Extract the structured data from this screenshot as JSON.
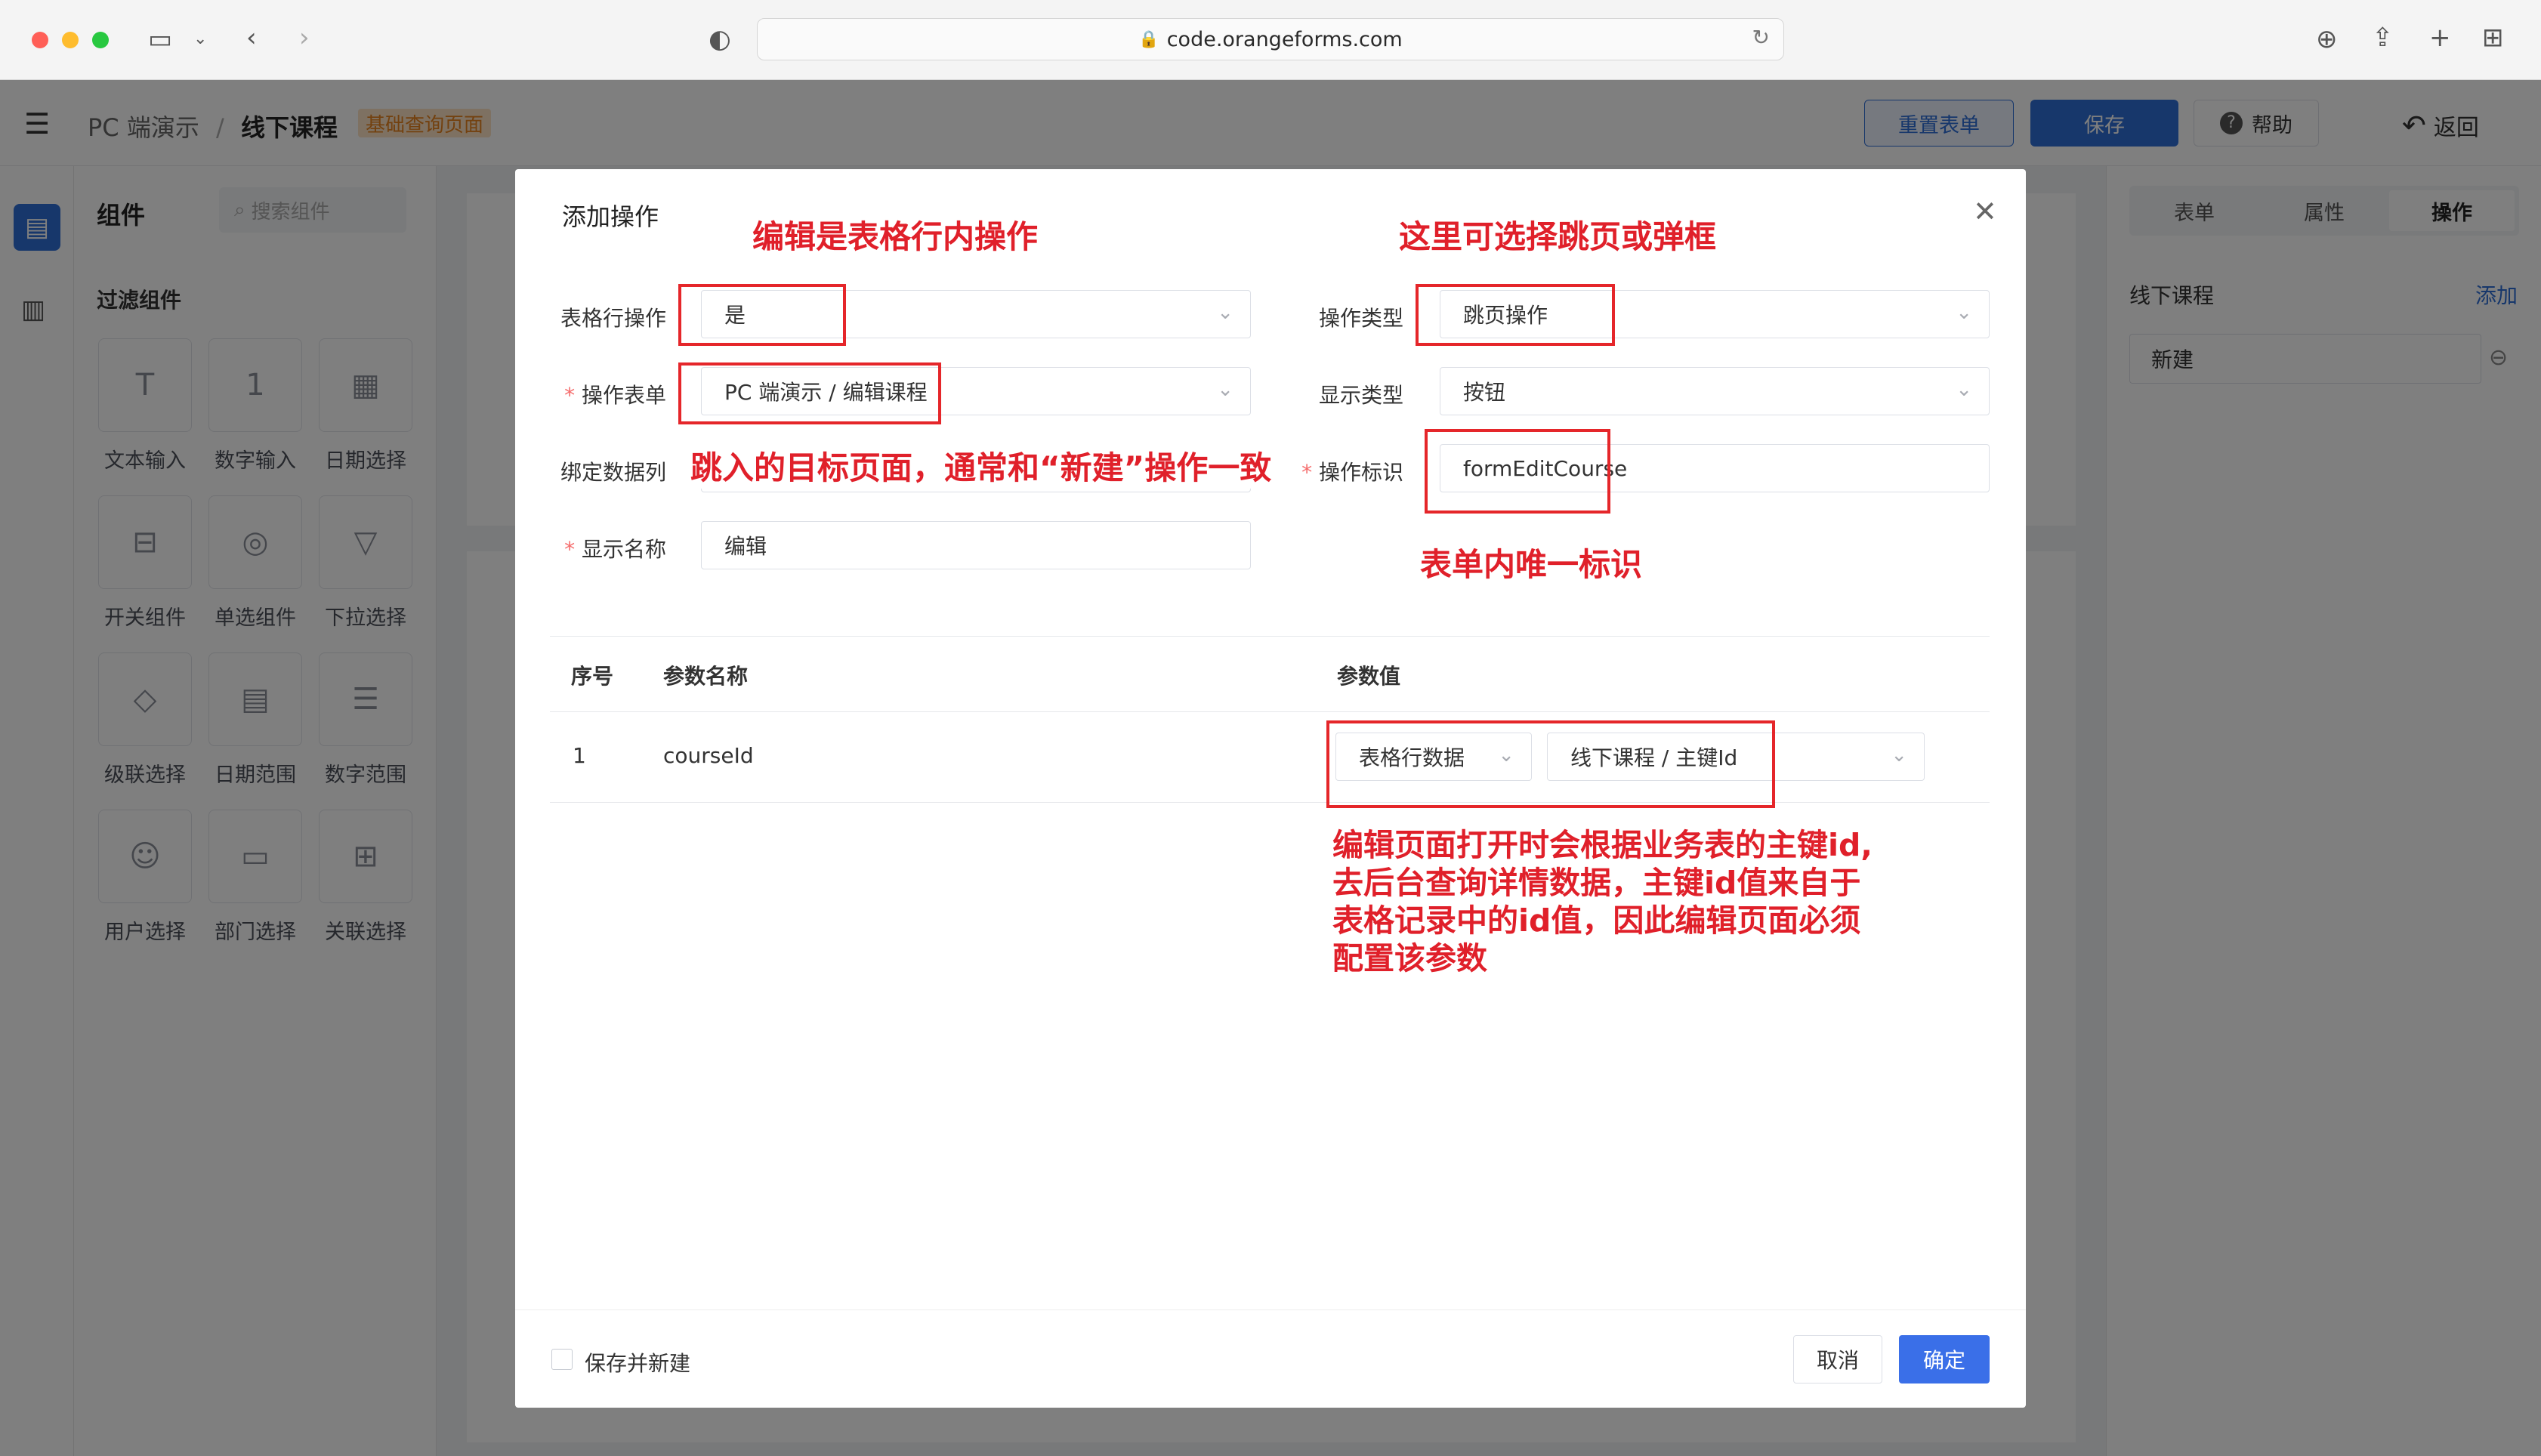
{
  "browser": {
    "url": "code.orangeforms.com"
  },
  "header": {
    "breadcrumb_root": "PC 端演示",
    "breadcrumb_sep": "/",
    "breadcrumb_current": "线下课程",
    "page_tag": "基础查询页面",
    "reset_label": "重置表单",
    "save_label": "保存",
    "help_label": "帮助",
    "back_label": "返回"
  },
  "left_panel": {
    "title": "组件",
    "search_placeholder": "搜索组件",
    "section_title": "过滤组件",
    "components": [
      {
        "label": "文本输入",
        "icon": "text-input-icon",
        "glyph": "T"
      },
      {
        "label": "数字输入",
        "icon": "number-input-icon",
        "glyph": "1"
      },
      {
        "label": "日期选择",
        "icon": "date-picker-icon",
        "glyph": "▦"
      },
      {
        "label": "开关组件",
        "icon": "switch-icon",
        "glyph": "⊟"
      },
      {
        "label": "单选组件",
        "icon": "radio-icon",
        "glyph": "◎"
      },
      {
        "label": "下拉选择",
        "icon": "dropdown-icon",
        "glyph": "▽"
      },
      {
        "label": "级联选择",
        "icon": "cascader-icon",
        "glyph": "◇"
      },
      {
        "label": "日期范围",
        "icon": "date-range-icon",
        "glyph": "▤"
      },
      {
        "label": "数字范围",
        "icon": "number-range-icon",
        "glyph": "☰"
      },
      {
        "label": "用户选择",
        "icon": "user-select-icon",
        "glyph": "☺"
      },
      {
        "label": "部门选择",
        "icon": "dept-select-icon",
        "glyph": "▭"
      },
      {
        "label": "关联选择",
        "icon": "relation-select-icon",
        "glyph": "⊞"
      }
    ]
  },
  "right_panel": {
    "tabs": [
      "表单",
      "属性",
      "操作"
    ],
    "active_tab": "操作",
    "section_title": "线下课程",
    "add_label": "添加",
    "item_label": "新建"
  },
  "dialog": {
    "title": "添加操作",
    "fields": {
      "row_op_label": "表格行操作",
      "row_op_value": "是",
      "op_type_label": "操作类型",
      "op_type_value": "跳页操作",
      "op_form_label": "操作表单",
      "op_form_value": "PC 端演示 / 编辑课程",
      "display_type_label": "显示类型",
      "display_type_value": "按钮",
      "bind_column_label": "绑定数据列",
      "op_id_label": "操作标识",
      "op_id_value": "formEditCourse",
      "display_name_label": "显示名称",
      "display_name_value": "编辑"
    },
    "table": {
      "headers": [
        "序号",
        "参数名称",
        "参数值"
      ],
      "rows": [
        {
          "index": "1",
          "name": "courseId",
          "source": "表格行数据",
          "value": "线下课程 / 主键Id"
        }
      ]
    },
    "footer": {
      "save_and_new": "保存并新建",
      "cancel": "取消",
      "confirm": "确定"
    }
  },
  "annotations": {
    "edit_row_note": "编辑是表格行内操作",
    "select_type_note": "这里可选择跳页或弹框",
    "target_page_note": "跳入的目标页面，通常和“新建”操作一致",
    "unique_id_note": "表单内唯一标识",
    "param_note": [
      "编辑页面打开时会根据业务表的主键id,",
      "去后台查询详情数据，主键id值来自于",
      "表格记录中的id值，因此编辑页面必须",
      "配置该参数"
    ]
  },
  "colors": {
    "primary": "#2f6fd6",
    "annotation_red": "#e0202a",
    "required_star": "#f56c6c",
    "confirm_button": "#3a6fe8"
  }
}
